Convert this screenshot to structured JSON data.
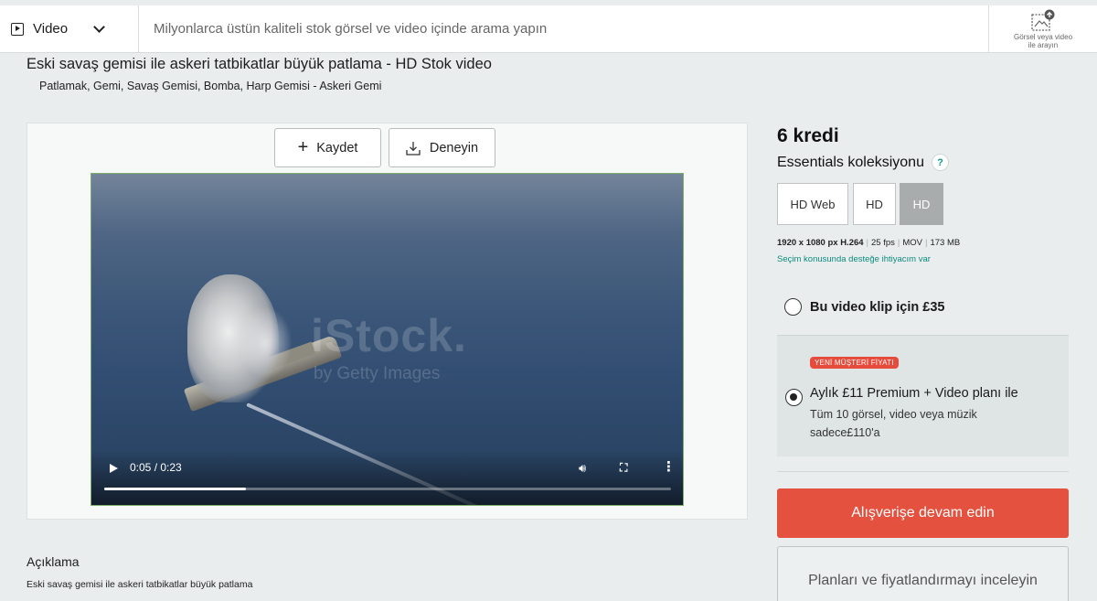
{
  "search": {
    "media_type": "Video",
    "placeholder": "Milyonlarca üstün kaliteli stok görsel ve video içinde arama yapın",
    "visual_search_label": "Görsel veya video ile arayın"
  },
  "page": {
    "title": "Eski savaş gemisi ile askeri tatbikatlar büyük patlama - HD Stok video",
    "keywords": "Patlamak, Gemi, Savaş Gemisi, Bomba, Harp Gemisi - Askeri Gemi"
  },
  "preview": {
    "save_label": "Kaydet",
    "try_label": "Deneyin",
    "watermark": "iStock.",
    "watermark_sub": "by Getty Images",
    "time": "0:05 / 0:23",
    "progress": 0.25
  },
  "description": {
    "heading": "Açıklama",
    "text": "Eski savaş gemisi ile askeri tatbikatlar büyük patlama"
  },
  "purchase": {
    "credits": "6 kredi",
    "collection": "Essentials koleksiyonu",
    "help": "?",
    "sizes": [
      "HD Web",
      "HD",
      "HD"
    ],
    "selected_size_index": 2,
    "specs": {
      "resolution": "1920 x 1080 px H.264",
      "fps": "25 fps",
      "format": "MOV",
      "filesize": "173 MB"
    },
    "support_link": "Seçim konusunda desteğe ihtiyacım var",
    "option_single": "Bu video klip için £35",
    "badge": "YENİ MÜŞTERİ FİYATI",
    "option_plan_title": "Aylık £11 Premium + Video planı ile",
    "option_plan_desc": "Tüm 10 görsel, video veya müzik sadece£110'a",
    "cta": "Alışverişe devam edin",
    "plans_button": "Planları ve fiyatlandırmayı inceleyin"
  },
  "colors": {
    "accent_red": "#e4513f",
    "teal_link": "#0c8a7d",
    "selected_size_bg": "#a9acac"
  }
}
